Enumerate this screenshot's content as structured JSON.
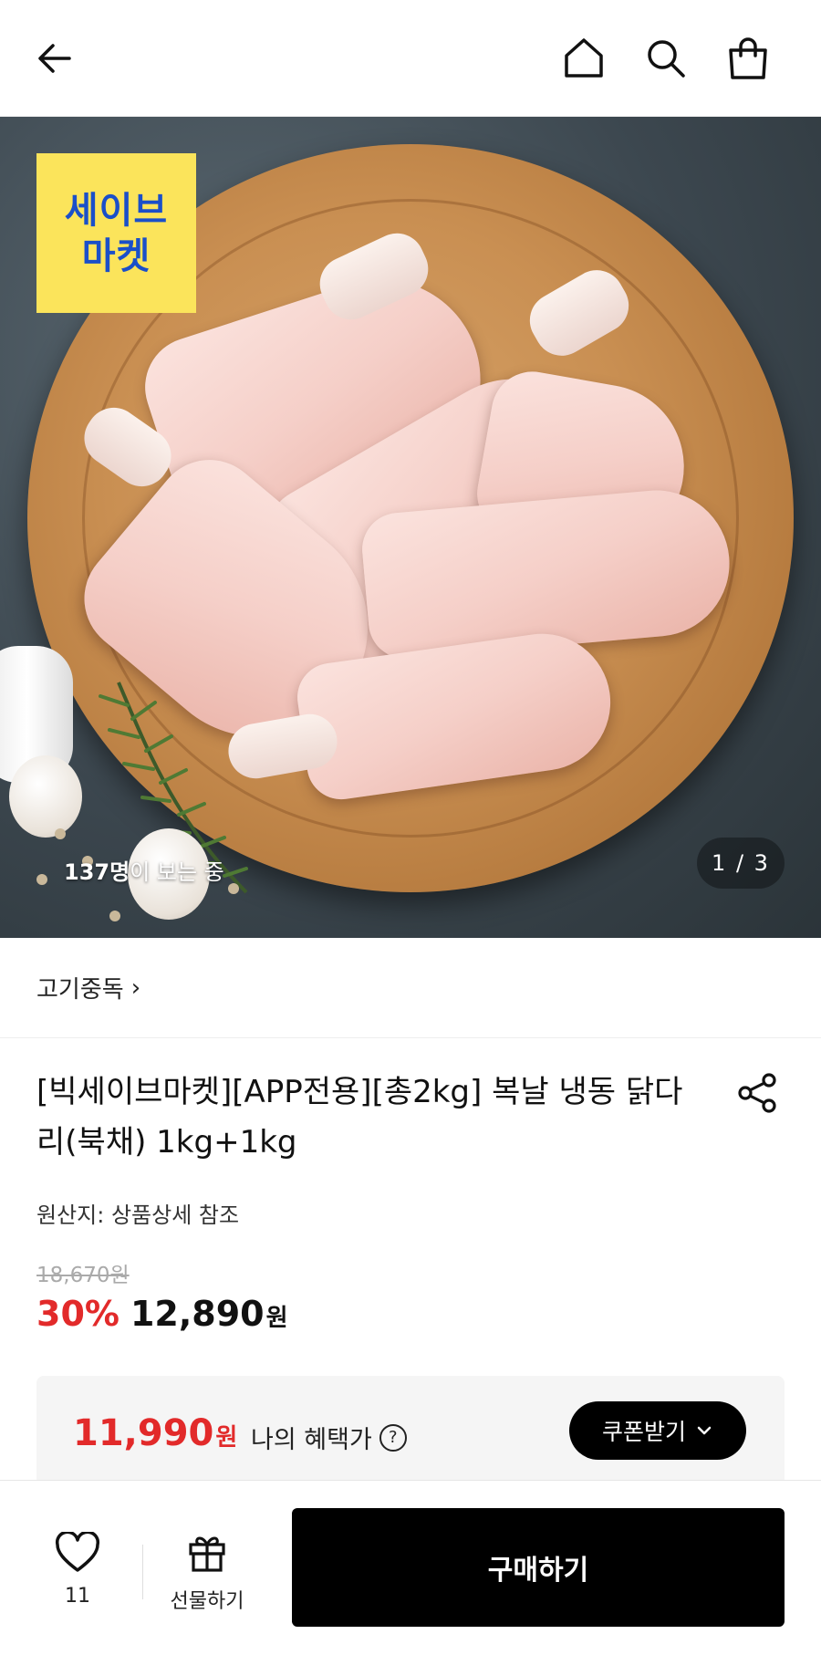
{
  "header": {
    "back_icon": "back-arrow-icon",
    "home_icon": "home-icon",
    "search_icon": "search-icon",
    "cart_icon": "shopping-bag-icon"
  },
  "hero": {
    "brand_badge": [
      "세이브",
      "마켓"
    ],
    "viewers_count": "137명",
    "viewers_suffix": "이 보는 중",
    "pager": "1 / 3"
  },
  "store": {
    "name": "고기중독",
    "chevron": "›"
  },
  "product": {
    "title": "[빅세이브마켓][APP전용][총2kg] 복날 냉동 닭다리(북채) 1kg+1kg",
    "origin": "원산지: 상품상세 참조",
    "original_price": "18,670원",
    "discount": "30%",
    "price": "12,890",
    "price_unit": "원"
  },
  "benefit": {
    "price": "11,990",
    "price_unit": "원",
    "label": "나의 혜택가",
    "help": "?",
    "coupon_button": "쿠폰받기",
    "coupon_chevron": "⌄"
  },
  "bottom_bar": {
    "like_count": "11",
    "gift_label": "선물하기",
    "buy_label": "구매하기"
  },
  "colors": {
    "accent_red": "#e22a2a",
    "badge_yellow": "#fbe45b",
    "badge_blue": "#1a4fc9",
    "buy_black": "#000000"
  }
}
